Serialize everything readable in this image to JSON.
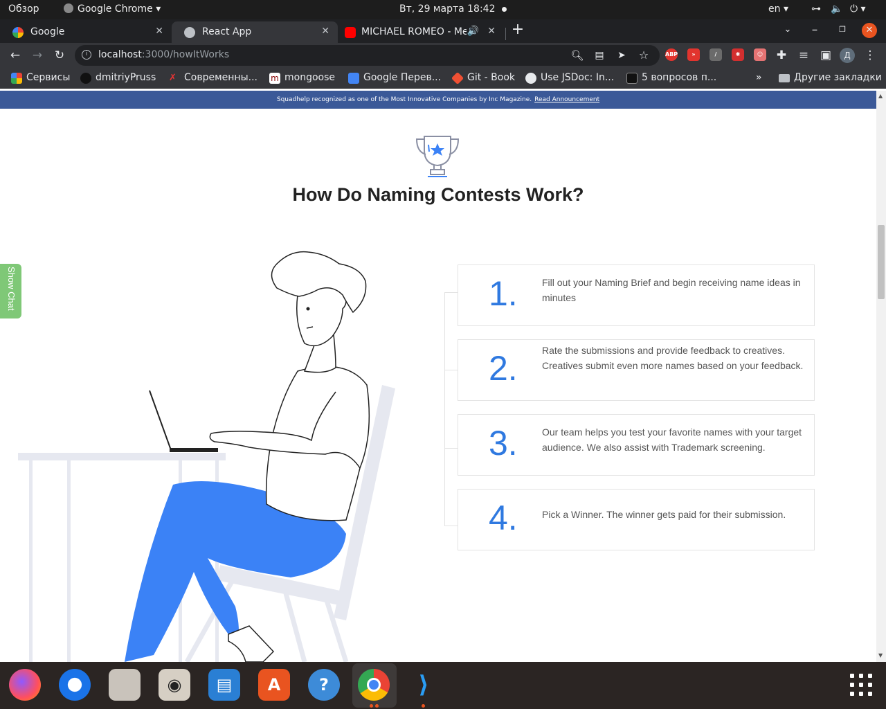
{
  "topbar": {
    "activities": "Обзор",
    "app_menu": "Google Chrome",
    "clock": "Вт, 29 марта  18:42",
    "lang": "en"
  },
  "tabs": [
    {
      "label": "Google",
      "icon": "google-icon"
    },
    {
      "label": "React App",
      "icon": "globe-icon"
    },
    {
      "label": "MICHAEL ROMEO - Me",
      "icon": "youtube-icon"
    }
  ],
  "toolbar": {
    "url_host": "localhost",
    "url_rest": ":3000/howItWorks",
    "profile_letter": "Д",
    "ext_abp": "ABP"
  },
  "bookmarks": {
    "items": [
      "Сервисы",
      "dmitriyPruss",
      "Современны...",
      "mongoose",
      "Google Перев...",
      "Git - Book",
      "Use JSDoc: In...",
      "5 вопросов п..."
    ],
    "overflow": "»",
    "other": "Другие закладки"
  },
  "page": {
    "banner_text": "Squadhelp recognized as one of the Most Innovative Companies by Inc Magazine.",
    "banner_link": "Read Announcement",
    "heading": "How Do Naming Contests Work?",
    "show_chat": "Show Chat",
    "steps": [
      {
        "num": "1.",
        "text": "Fill out your Naming Brief and begin receiving name ideas in minutes"
      },
      {
        "num": "2.",
        "text": "Rate the submissions and provide feedback to creatives. Creatives submit even more names based on your feedback."
      },
      {
        "num": "3.",
        "text": "Our team helps you test your favorite names with your target audience. We also assist with Trademark screening."
      },
      {
        "num": "4.",
        "text": "Pick a Winner. The winner gets paid for their submission."
      }
    ]
  },
  "colors": {
    "banner": "#3b5998",
    "step_number": "#2f79e0",
    "illustration_blue": "#3b82f6",
    "show_chat": "#7fc877"
  },
  "dock": {
    "apps": [
      "firefox-icon",
      "thunderbird-icon",
      "files-icon",
      "rhythmbox-icon",
      "writer-icon",
      "software-icon",
      "help-icon",
      "chrome-icon",
      "vscode-icon"
    ],
    "help_glyph": "?"
  }
}
